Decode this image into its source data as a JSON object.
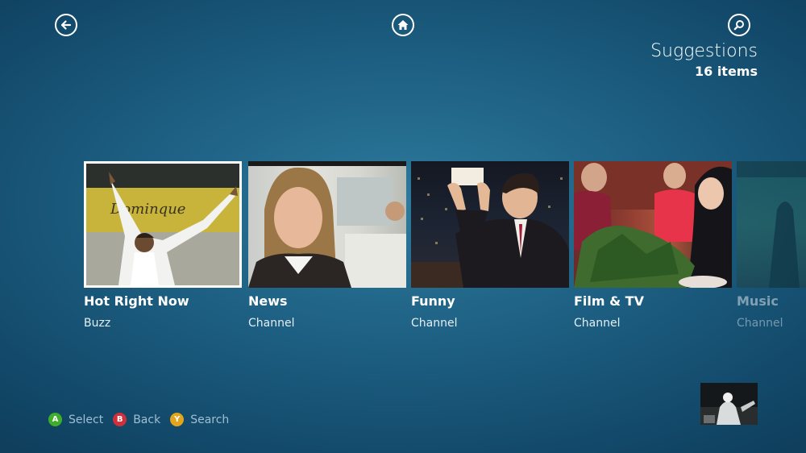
{
  "header": {
    "title": "Suggestions",
    "count": "16 items",
    "icons": {
      "back": "back-arrow-icon",
      "home": "home-icon",
      "search": "search-icon"
    }
  },
  "tiles": [
    {
      "name": "Hot Right Now",
      "kind": "Buzz",
      "selected": true
    },
    {
      "name": "News",
      "kind": "Channel"
    },
    {
      "name": "Funny",
      "kind": "Channel"
    },
    {
      "name": "Film & TV",
      "kind": "Channel"
    },
    {
      "name": "Music",
      "kind": "Channel"
    }
  ],
  "legend": [
    {
      "button": "A",
      "label": "Select",
      "color": "#3fae2a"
    },
    {
      "button": "B",
      "label": "Back",
      "color": "#d0303a"
    },
    {
      "button": "Y",
      "label": "Search",
      "color": "#e3a51c"
    }
  ]
}
